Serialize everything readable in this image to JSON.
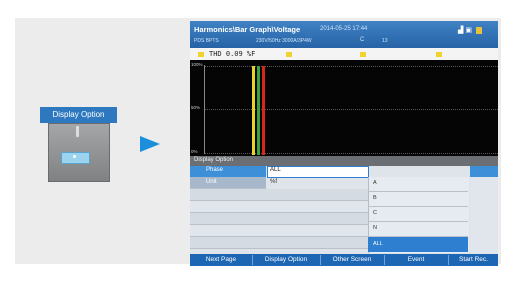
{
  "left_panel": {
    "label": "Display Option"
  },
  "screen": {
    "title": "Harmonics\\Bar Graph\\Voltage",
    "datetime": "2014-05-25 17:44",
    "sub_left": "PDS BPTS",
    "sub_mid": "230V/50Hz  3000A/3P4W",
    "sub_sym": "C",
    "sub_num": "13",
    "graph": {
      "thd_label": "THD 0.09 %F",
      "y_labels": [
        "100%",
        "50%",
        "0%"
      ]
    },
    "option_header": "Display Option",
    "rows": [
      {
        "label": "Phase",
        "value": "ALL"
      },
      {
        "label": "Unit",
        "value": "%f"
      }
    ],
    "dropdown": [
      "A",
      "B",
      "C",
      "N",
      "ALL"
    ],
    "buttons": [
      "Next Page",
      "Display Option",
      "Other Screen",
      "Event",
      "Start Rec."
    ]
  },
  "colors": {
    "accent_blue": "#1d66b3",
    "selected_blue": "#2f7fd1",
    "bar_yellow": "#e8d22a",
    "bar_green": "#3aa33a",
    "bar_red": "#d8261f"
  }
}
